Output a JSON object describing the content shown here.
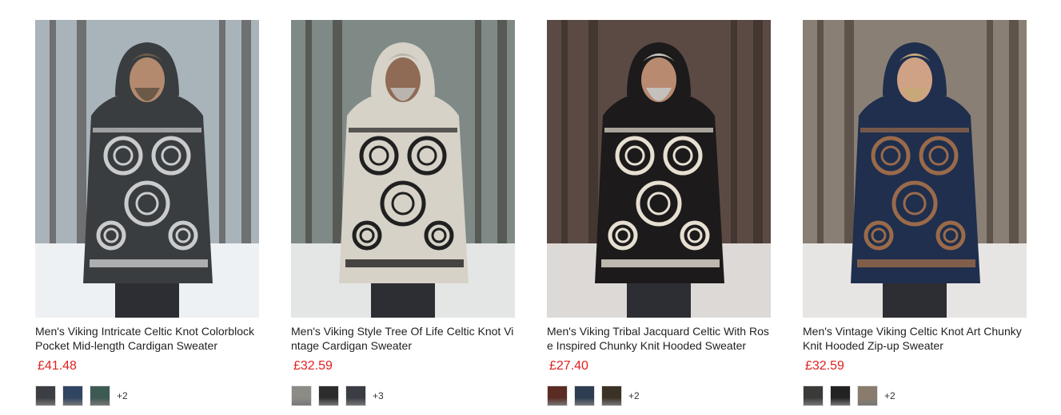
{
  "products": [
    {
      "title": "Men's Viking Intricate Celtic Knot Colorblock Pocket Mid-length Cardigan Sweater",
      "price": "£41.48",
      "photo": {
        "bg": "#a9b3ba",
        "ground": "#eef1f3",
        "garment": "#3a3d40",
        "pattern": "#c9cbcc",
        "skin": "#b48a6e",
        "hair": "#6b5a48"
      },
      "swatches": [
        "#3b3e42",
        "#2f4562",
        "#3e5a55"
      ],
      "more": "+2"
    },
    {
      "title": "Men's Viking Style Tree Of Life Celtic Knot Vintage Cardigan Sweater",
      "price": "£32.59",
      "photo": {
        "bg": "#7f8a86",
        "ground": "#e4e6e6",
        "garment": "#d6d2c8",
        "pattern": "#202020",
        "skin": "#8f6a54",
        "hair": "#b9b4ad"
      },
      "swatches": [
        "#8d8b86",
        "#2c2c2c",
        "#3a3d44"
      ],
      "more": "+3"
    },
    {
      "title": "Men's Viking Tribal Jacquard Celtic With Rose Inspired Chunky Knit Hooded Sweater",
      "price": "£27.40",
      "photo": {
        "bg": "#5b4a44",
        "ground": "#ddd9d6",
        "garment": "#1c1a1a",
        "pattern": "#e6dfd2",
        "skin": "#b88a70",
        "hair": "#c4c0bb"
      },
      "swatches": [
        "#5a2c24",
        "#2f3d52",
        "#3b3226"
      ],
      "more": "+2"
    },
    {
      "title": "Men's Vintage Viking Celtic Knot Art Chunky Knit Hooded Zip-up Sweater",
      "price": "£32.59",
      "photo": {
        "bg": "#8a7f74",
        "ground": "#e7e5e3",
        "garment": "#1f2f4d",
        "pattern": "#9a6a4a",
        "skin": "#d0a285",
        "hair": "#c8a878"
      },
      "swatches": [
        "#3a3a38",
        "#222222",
        "#8a7c6c"
      ],
      "more": "+2"
    }
  ]
}
